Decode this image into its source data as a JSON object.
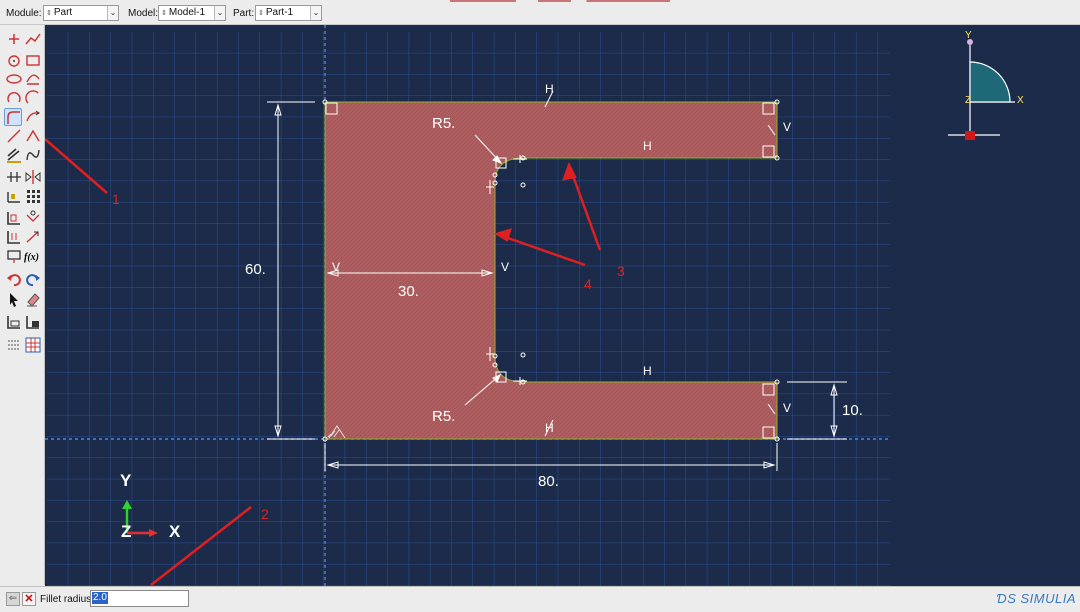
{
  "context_bar": {
    "module_label": "Module:",
    "module_value": "Part",
    "model_label": "Model:",
    "model_value": "Model-1",
    "part_label": "Part:",
    "part_value": "Part-1"
  },
  "toolbox": {
    "tools": [
      "create-point-icon",
      "create-spline-icon",
      "circle-icon",
      "rectangle-icon",
      "ellipse-icon",
      "arc-tangent-icon",
      "arc-center-icon",
      "arc-three-point-icon",
      "fillet-icon",
      "arc-tangent-2-icon",
      "construction-line-icon",
      "line-icon",
      "offset-icon",
      "spline-icon",
      "constraint-icon",
      "mirror-icon",
      "dimension-icon",
      "grid-pattern-icon",
      "translate-icon",
      "copy-icon",
      "move-icon",
      "scale-icon",
      "parameter-icon",
      "function-icon",
      "undo-icon",
      "redo-icon",
      "select-icon",
      "erase-icon",
      "save-sketch-icon",
      "retrieve-sketch-icon",
      "sketch-options-icon",
      "grid-icon"
    ],
    "function_label": "f(x)"
  },
  "viewport": {
    "dimensions": {
      "height_60": "60.",
      "width_30": "30.",
      "width_80": "80.",
      "height_10": "10.",
      "radius_top": "R5.",
      "radius_bottom": "R5."
    },
    "constraint_labels": {
      "h": "H",
      "v": "V"
    },
    "triad_top": {
      "y": "Y",
      "x": "X",
      "z": "Z"
    },
    "triad_bottom": {
      "y": "Y",
      "x": "X",
      "z": "Z"
    },
    "annotations": [
      "1",
      "2",
      "3",
      "4"
    ],
    "colors": {
      "background": "#1c2b4a",
      "grid": "#2f5aa8",
      "profile_fill": "#a8585a",
      "annotation": "#e02020"
    }
  },
  "prompt": {
    "label": "Fillet radius:",
    "value": "2.0"
  },
  "brand": "SIMULIA"
}
